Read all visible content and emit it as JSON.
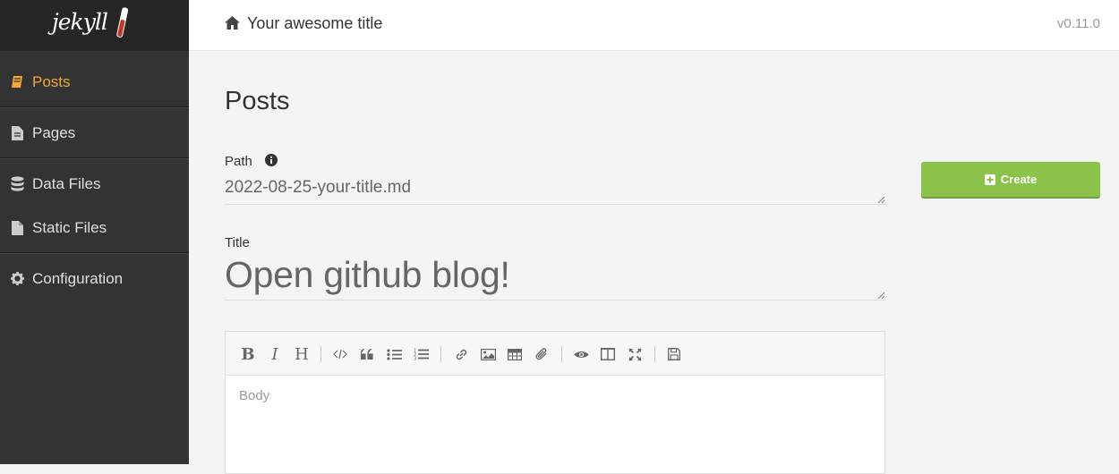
{
  "logo": {
    "text": "jekyll"
  },
  "sidebar": {
    "items": [
      {
        "label": "Posts",
        "icon": "book-icon",
        "active": true
      },
      {
        "label": "Pages",
        "icon": "file-text-icon"
      },
      {
        "label": "Data Files",
        "icon": "database-icon"
      },
      {
        "label": "Static Files",
        "icon": "file-icon"
      },
      {
        "label": "Configuration",
        "icon": "gear-icon"
      }
    ]
  },
  "header": {
    "title": "Your awesome title",
    "version": "v0.11.0"
  },
  "main": {
    "page_title": "Posts",
    "path_label": "Path",
    "path_value": "2022-08-25-your-title.md",
    "title_label": "Title",
    "title_value": "Open github blog!",
    "create_label": "Create",
    "body_placeholder": "Body"
  },
  "editor": {
    "toolbar": [
      "bold",
      "italic",
      "heading",
      "code",
      "quote",
      "unordered-list",
      "ordered-list",
      "link",
      "image",
      "table",
      "attachment",
      "preview",
      "side-by-side",
      "fullscreen",
      "save"
    ]
  },
  "colors": {
    "accent": "#f4a73c",
    "create": "#8bc34a",
    "sidebar": "#333333"
  }
}
